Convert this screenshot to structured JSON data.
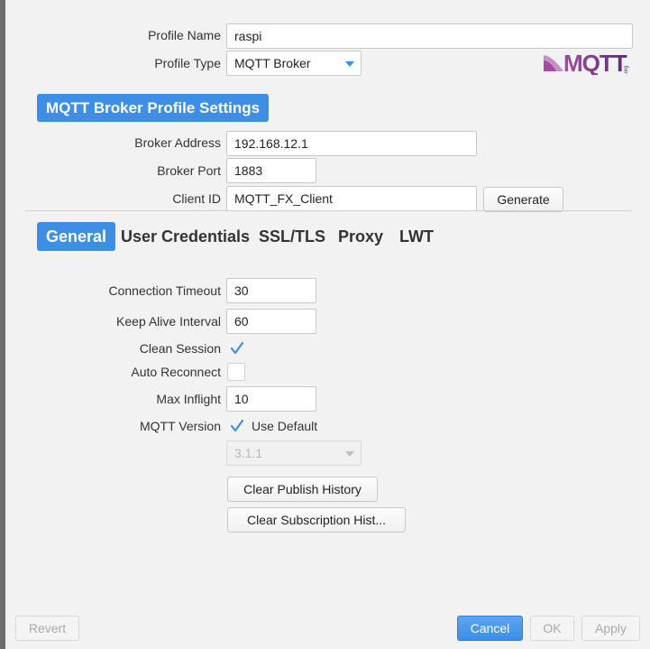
{
  "profile": {
    "name_label": "Profile Name",
    "name_value": "raspi",
    "type_label": "Profile Type",
    "type_value": "MQTT Broker",
    "logo_text": "MQTT",
    "logo_sub": ".org"
  },
  "broker": {
    "section_title": "MQTT Broker Profile Settings",
    "address_label": "Broker Address",
    "address_value": "192.168.12.1",
    "port_label": "Broker Port",
    "port_value": "1883",
    "client_id_label": "Client ID",
    "client_id_value": "MQTT_FX_Client",
    "generate_label": "Generate"
  },
  "tabs": [
    {
      "label": "General",
      "active": true
    },
    {
      "label": "User Credentials",
      "active": false
    },
    {
      "label": "SSL/TLS",
      "active": false
    },
    {
      "label": "Proxy",
      "active": false
    },
    {
      "label": "LWT",
      "active": false
    }
  ],
  "general": {
    "timeout_label": "Connection Timeout",
    "timeout_value": "30",
    "keepalive_label": "Keep Alive Interval",
    "keepalive_value": "60",
    "clean_session_label": "Clean Session",
    "clean_session_checked": true,
    "auto_reconnect_label": "Auto Reconnect",
    "auto_reconnect_checked": false,
    "max_inflight_label": "Max Inflight",
    "max_inflight_value": "10",
    "mqtt_version_label": "MQTT Version",
    "use_default_label": "Use Default",
    "use_default_checked": true,
    "version_value": "3.1.1",
    "clear_publish_label": "Clear Publish History",
    "clear_subscription_label": "Clear Subscription Hist..."
  },
  "footer": {
    "revert_label": "Revert",
    "cancel_label": "Cancel",
    "ok_label": "OK",
    "apply_label": "Apply"
  },
  "colors": {
    "accent": "#3d8ee4",
    "logo_purple": "#6b2f84"
  }
}
